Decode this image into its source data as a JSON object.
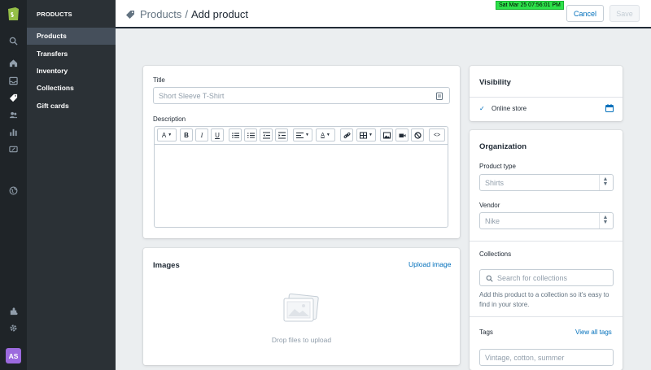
{
  "rail": {
    "icons": [
      "search-icon",
      "home-icon",
      "orders-icon",
      "products-icon",
      "customers-icon",
      "analytics-icon",
      "discounts-icon",
      "online-store-icon",
      "apps-icon",
      "settings-icon"
    ],
    "avatar_initials": "AS"
  },
  "subnav": {
    "header": "PRODUCTS",
    "items": [
      {
        "label": "Products",
        "active": true
      },
      {
        "label": "Transfers",
        "active": false
      },
      {
        "label": "Inventory",
        "active": false
      },
      {
        "label": "Collections",
        "active": false
      },
      {
        "label": "Gift cards",
        "active": false
      }
    ]
  },
  "topbar": {
    "breadcrumb_link": "Products",
    "separator": "/",
    "page_title": "Add product",
    "clock": "Sat Mar 25 07:56:01 PM",
    "cancel_label": "Cancel",
    "save_label": "Save"
  },
  "product": {
    "title_label": "Title",
    "title_placeholder": "Short Sleeve T-Shirt",
    "description_label": "Description",
    "toolbar": {
      "font_label": "A",
      "bold": "B",
      "italic": "I",
      "underline": "U",
      "text_color": "A",
      "code": "<>"
    }
  },
  "images": {
    "title": "Images",
    "upload_link": "Upload image",
    "drop_text": "Drop files to upload"
  },
  "visibility": {
    "title": "Visibility",
    "channel": "Online store",
    "checked": true
  },
  "organization": {
    "title": "Organization",
    "product_type_label": "Product type",
    "product_type_placeholder": "Shirts",
    "vendor_label": "Vendor",
    "vendor_placeholder": "Nike",
    "collections_label": "Collections",
    "collections_placeholder": "Search for collections",
    "collections_help": "Add this product to a collection so it's easy to find in your store.",
    "tags_label": "Tags",
    "view_all_tags": "View all tags",
    "tags_placeholder": "Vintage, cotton, summer"
  },
  "colors": {
    "rail_bg": "#1f2428",
    "subnav_bg": "#2b3136",
    "active_item": "#454f5b",
    "link": "#006fbb",
    "avatar": "#9c6ade",
    "clock_bg": "#2de24a"
  }
}
